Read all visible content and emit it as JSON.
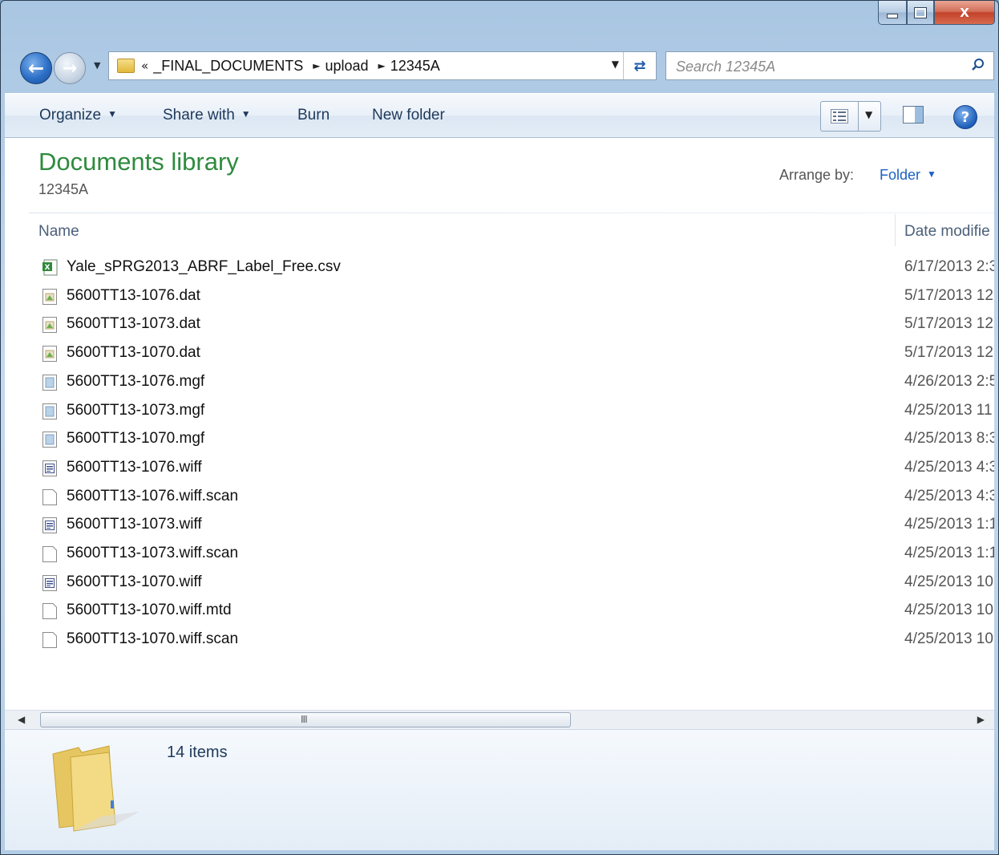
{
  "window": {
    "caption_buttons": [
      "minimize",
      "maximize",
      "close"
    ],
    "close_label": "X"
  },
  "nav": {
    "overflow_chevron": "«",
    "breadcrumb": [
      "_FINAL_DOCUMENTS",
      "upload",
      "12345A"
    ]
  },
  "search": {
    "placeholder": "Search 12345A"
  },
  "toolbar": {
    "organize": "Organize",
    "share_with": "Share with",
    "burn": "Burn",
    "new_folder": "New folder"
  },
  "library": {
    "title": "Documents library",
    "subtitle": "12345A",
    "arrange_label": "Arrange by:",
    "arrange_value": "Folder"
  },
  "columns": {
    "name": "Name",
    "date": "Date modifie"
  },
  "files": [
    {
      "name": "Yale_sPRG2013_ABRF_Label_Free.csv",
      "date": "6/17/2013 2:3",
      "icon": "excel-csv-icon"
    },
    {
      "name": "5600TT13-1076.dat",
      "date": "5/17/2013 12",
      "icon": "dat-file-icon"
    },
    {
      "name": "5600TT13-1073.dat",
      "date": "5/17/2013 12",
      "icon": "dat-file-icon"
    },
    {
      "name": "5600TT13-1070.dat",
      "date": "5/17/2013 12",
      "icon": "dat-file-icon"
    },
    {
      "name": "5600TT13-1076.mgf",
      "date": "4/26/2013 2:5",
      "icon": "mgf-file-icon"
    },
    {
      "name": "5600TT13-1073.mgf",
      "date": "4/25/2013 11",
      "icon": "mgf-file-icon"
    },
    {
      "name": "5600TT13-1070.mgf",
      "date": "4/25/2013 8:3",
      "icon": "mgf-file-icon"
    },
    {
      "name": "5600TT13-1076.wiff",
      "date": "4/25/2013 4:3",
      "icon": "wiff-file-icon"
    },
    {
      "name": "5600TT13-1076.wiff.scan",
      "date": "4/25/2013 4:3",
      "icon": "blank-file-icon"
    },
    {
      "name": "5600TT13-1073.wiff",
      "date": "4/25/2013 1:1",
      "icon": "wiff-file-icon"
    },
    {
      "name": "5600TT13-1073.wiff.scan",
      "date": "4/25/2013 1:1",
      "icon": "blank-file-icon"
    },
    {
      "name": "5600TT13-1070.wiff",
      "date": "4/25/2013 10",
      "icon": "wiff-file-icon"
    },
    {
      "name": "5600TT13-1070.wiff.mtd",
      "date": "4/25/2013 10",
      "icon": "blank-file-icon"
    },
    {
      "name": "5600TT13-1070.wiff.scan",
      "date": "4/25/2013 10",
      "icon": "blank-file-icon"
    }
  ],
  "scrollbar": {
    "grip": "III"
  },
  "details": {
    "item_count": "14 items"
  },
  "colors": {
    "library_title": "#2e8b3e",
    "link_blue": "#1c62c4",
    "toolbar_text": "#1e395b"
  }
}
